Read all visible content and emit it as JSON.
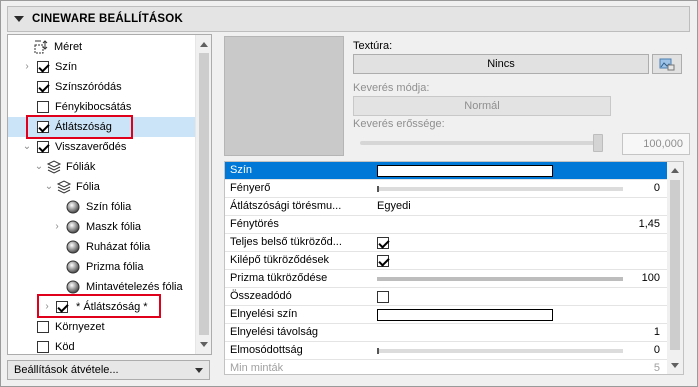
{
  "panel": {
    "title": "CINEWARE BEÁLLÍTÁSOK"
  },
  "tree": {
    "items": [
      {
        "label": "Méret",
        "icon": "size-arrows-icon",
        "checked": null
      },
      {
        "label": "Szín",
        "checked": true,
        "expandable": true
      },
      {
        "label": "Színszóródás",
        "checked": true
      },
      {
        "label": "Fénykibocsátás",
        "checked": false
      },
      {
        "label": "Átlátszóság",
        "checked": true,
        "selected": true,
        "highlighted": true
      },
      {
        "label": "Visszaverődés",
        "checked": true,
        "expanded": true
      },
      {
        "label": "Fóliák",
        "icon": "layers-icon",
        "expanded": true
      },
      {
        "label": "Fólia",
        "icon": "layers-icon",
        "expanded": true
      },
      {
        "label": "Szín fólia",
        "icon": "sphere-icon"
      },
      {
        "label": "Maszk fólia",
        "icon": "sphere-icon",
        "expandable": true
      },
      {
        "label": "Ruházat fólia",
        "icon": "sphere-icon"
      },
      {
        "label": "Prizma fólia",
        "icon": "sphere-icon"
      },
      {
        "label": "Mintavételezés fólia",
        "icon": "sphere-icon"
      },
      {
        "label": "* Átlátszóság *",
        "checked": true,
        "expandable": true,
        "highlighted": true
      },
      {
        "label": "Környezet",
        "checked": false
      },
      {
        "label": "Köd",
        "checked": false
      }
    ],
    "apply_button": "Beállítások átvétele..."
  },
  "texture": {
    "label": "Textúra:",
    "value": "Nincs",
    "blend_mode_label": "Keverés módja:",
    "blend_mode_value": "Normál",
    "blend_strength_label": "Keverés erőssége:",
    "blend_strength_value": "100,000"
  },
  "properties": [
    {
      "name": "Szín",
      "type": "color",
      "selected": true
    },
    {
      "name": "Fényerő",
      "type": "slider",
      "fraction": 0.0,
      "value": "0"
    },
    {
      "name": "Átlátszósági törésmu...",
      "type": "text",
      "text": "Egyedi"
    },
    {
      "name": "Fénytörés",
      "type": "number",
      "value": "1,45"
    },
    {
      "name": "Teljes belső tükröződ...",
      "type": "checkbox",
      "checked": true
    },
    {
      "name": "Kilépő tükröződések",
      "type": "checkbox",
      "checked": true
    },
    {
      "name": "Prizma tükröződése",
      "type": "slider",
      "fraction": 1.0,
      "value": "100"
    },
    {
      "name": "Összeadódó",
      "type": "checkbox",
      "checked": false
    },
    {
      "name": "Elnyelési szín",
      "type": "color"
    },
    {
      "name": "Elnyelési távolság",
      "type": "number",
      "value": "1"
    },
    {
      "name": "Elmosódottság",
      "type": "slider",
      "fraction": 0.0,
      "value": "0"
    },
    {
      "name": "Min minták",
      "type": "number",
      "value": "5",
      "disabled": true
    }
  ],
  "colors": {
    "selection": "#0078d7",
    "highlight_box": "#e0001b",
    "tree_selection": "#cce4f7"
  }
}
